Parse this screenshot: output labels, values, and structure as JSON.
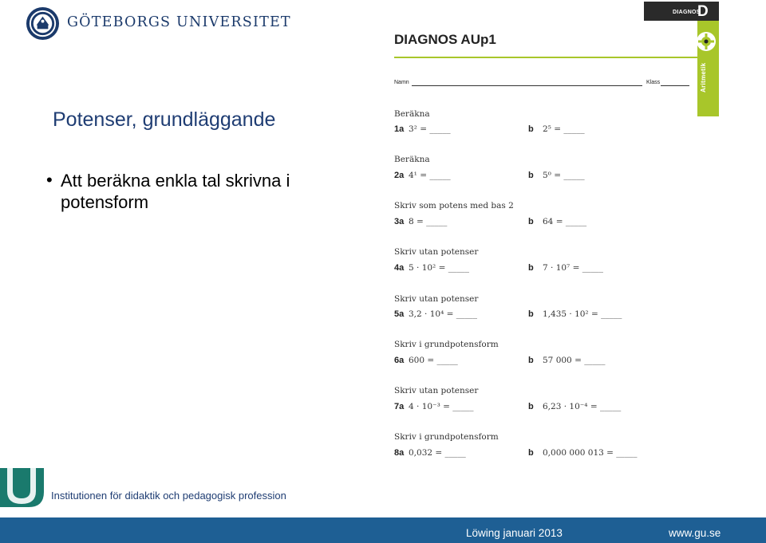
{
  "header": {
    "university": "GÖTEBORGS UNIVERSITET",
    "seal_icon": "university-seal-icon"
  },
  "slide": {
    "title": "Potenser, grundläggande",
    "bullet": "Att beräkna enkla tal skrivna i potensform"
  },
  "worksheet": {
    "title": "DIAGNOS AUp1",
    "name_label": "Namn",
    "class_label": "Klass",
    "tab_small": "DIAGNOS",
    "tab_letter": "D",
    "tab_subject": "Aritmetik",
    "accent_color": "#a8c62a",
    "questions": [
      {
        "heading": "Beräkna",
        "a_num": "1a",
        "a_expr": "3² = _____",
        "b_num": "b",
        "b_expr": "2⁵ = _____"
      },
      {
        "heading": "Beräkna",
        "a_num": "2a",
        "a_expr": "4¹ = _____",
        "b_num": "b",
        "b_expr": "5⁰ = _____"
      },
      {
        "heading": "Skriv som potens med bas 2",
        "a_num": "3a",
        "a_expr": "8 = _____",
        "b_num": "b",
        "b_expr": "64 = _____"
      },
      {
        "heading": "Skriv utan potenser",
        "a_num": "4a",
        "a_expr": "5 · 10² = _____",
        "b_num": "b",
        "b_expr": "7 · 10⁷ = _____"
      },
      {
        "heading": "Skriv utan potenser",
        "a_num": "5a",
        "a_expr": "3,2 · 10⁴  = _____",
        "b_num": "b",
        "b_expr": "1,435 · 10² = _____"
      },
      {
        "heading": "Skriv i grundpotensform",
        "a_num": "6a",
        "a_expr": "600 = _____",
        "b_num": "b",
        "b_expr": "57 000  = _____"
      },
      {
        "heading": "Skriv utan potenser",
        "a_num": "7a",
        "a_expr": "4 · 10⁻³ = _____",
        "b_num": "b",
        "b_expr": "6,23 · 10⁻⁴ = _____"
      },
      {
        "heading": "Skriv i grundpotensform",
        "a_num": "8a",
        "a_expr": "0,032 = _____",
        "b_num": "b",
        "b_expr": "0,000 000 013 = _____"
      }
    ]
  },
  "footer": {
    "department": "Institutionen för didaktik och pedagogisk profession",
    "date": "Löwing januari 2013",
    "website": "www.gu.se",
    "bar_color": "#1e5f94",
    "logo_icon": "gu-u-logo-icon"
  }
}
